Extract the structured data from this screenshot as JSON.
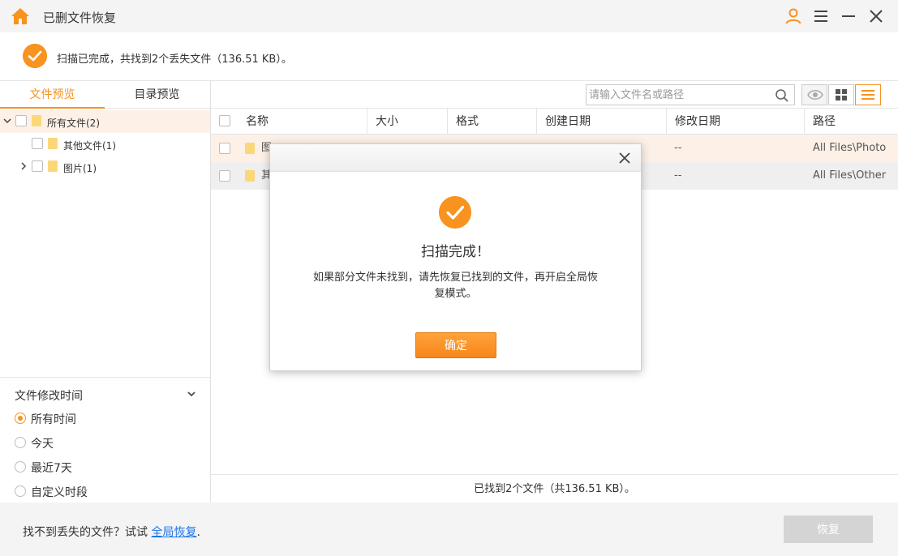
{
  "app": {
    "title": "已删文件恢复"
  },
  "status": {
    "message": "扫描已完成，共找到2个丢失文件（136.51 KB）。"
  },
  "left_tabs": [
    {
      "label": "文件预览",
      "active": true
    },
    {
      "label": "目录预览",
      "active": false
    }
  ],
  "tree": [
    {
      "label": "所有文件(2)",
      "expanded": true
    },
    {
      "label": "其他文件(1)"
    },
    {
      "label": "图片(1)",
      "expanded": false
    }
  ],
  "filter": {
    "title": "文件修改时间",
    "options": [
      {
        "label": "所有时间",
        "selected": true
      },
      {
        "label": "今天",
        "selected": false
      },
      {
        "label": "最近7天",
        "selected": false
      },
      {
        "label": "自定义时段",
        "selected": false
      }
    ]
  },
  "search": {
    "placeholder": "请输入文件名或路径",
    "value": ""
  },
  "table": {
    "columns": [
      "名称",
      "大小",
      "格式",
      "创建日期",
      "修改日期",
      "路径"
    ],
    "rows": [
      {
        "name": "图",
        "modified": "--",
        "path": "All Files\\Photo"
      },
      {
        "name": "其",
        "modified": "--",
        "path": "All Files\\Other"
      }
    ]
  },
  "footer": {
    "count": "已找到2个文件（共136.51 KB）。"
  },
  "bottom": {
    "hint": "找不到丢失的文件？试试",
    "link": "全局恢复",
    "period": ".",
    "recover_label": "恢复"
  },
  "dialog": {
    "title": "扫描完成！",
    "message": "如果部分文件未找到，请先恢复已找到的文件，再开启全局恢复模式。",
    "ok_label": "确定"
  },
  "colors": {
    "accent": "#f7931e",
    "link": "#1a73e8",
    "disabled_button": "#d4d4d4"
  }
}
